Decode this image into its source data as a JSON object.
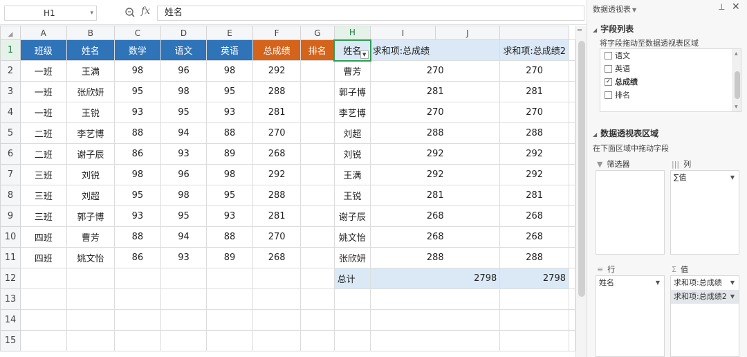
{
  "formula_bar": {
    "name_box": "H1",
    "fx_label": "fx",
    "formula_value": "姓名"
  },
  "columns": [
    "A",
    "B",
    "C",
    "D",
    "E",
    "F",
    "G",
    "H",
    "I",
    "J"
  ],
  "rows": [
    "1",
    "2",
    "3",
    "4",
    "5",
    "6",
    "7",
    "8",
    "9",
    "10",
    "11",
    "12",
    "13",
    "14",
    "15"
  ],
  "source_table": {
    "headers": [
      "班级",
      "姓名",
      "数学",
      "语文",
      "英语",
      "总成绩",
      "排名"
    ],
    "rows": [
      [
        "一班",
        "王满",
        "98",
        "96",
        "98",
        "292"
      ],
      [
        "一班",
        "张欣妍",
        "95",
        "98",
        "95",
        "288"
      ],
      [
        "一班",
        "王锐",
        "93",
        "95",
        "93",
        "281"
      ],
      [
        "二班",
        "李艺博",
        "88",
        "94",
        "88",
        "270"
      ],
      [
        "二班",
        "谢子辰",
        "86",
        "93",
        "89",
        "268"
      ],
      [
        "三班",
        "刘锐",
        "98",
        "96",
        "98",
        "292"
      ],
      [
        "三班",
        "刘超",
        "95",
        "98",
        "95",
        "288"
      ],
      [
        "三班",
        "郭子博",
        "93",
        "95",
        "93",
        "281"
      ],
      [
        "四班",
        "曹芳",
        "88",
        "94",
        "88",
        "270"
      ],
      [
        "四班",
        "姚文怡",
        "86",
        "93",
        "89",
        "268"
      ]
    ]
  },
  "pivot": {
    "headers": [
      "姓名",
      "求和项:总成绩",
      "求和项:总成绩2"
    ],
    "rows": [
      [
        "曹芳",
        "270",
        "270"
      ],
      [
        "郭子博",
        "281",
        "281"
      ],
      [
        "李艺博",
        "270",
        "270"
      ],
      [
        "刘超",
        "288",
        "288"
      ],
      [
        "刘锐",
        "292",
        "292"
      ],
      [
        "王满",
        "292",
        "292"
      ],
      [
        "王锐",
        "281",
        "281"
      ],
      [
        "谢子辰",
        "268",
        "268"
      ],
      [
        "姚文怡",
        "268",
        "268"
      ],
      [
        "张欣妍",
        "288",
        "288"
      ]
    ],
    "total": [
      "总计",
      "2798",
      "2798"
    ]
  },
  "panel": {
    "title": "数据透视表",
    "field_list_title": "字段列表",
    "field_list_hint": "将字段拖动至数据透视表区域",
    "fields": [
      {
        "label": "语文",
        "checked": false
      },
      {
        "label": "英语",
        "checked": false
      },
      {
        "label": "总成绩",
        "checked": true
      },
      {
        "label": "排名",
        "checked": false
      }
    ],
    "areas_title": "数据透视表区域",
    "areas_hint": "在下面区域中拖动字段",
    "filter_label": "筛选器",
    "columns_label": "列",
    "columns_item": "∑值",
    "rows_label": "行",
    "rows_item": "姓名",
    "values_label": "值",
    "values_items": [
      "求和项:总成绩",
      "求和项:总成绩2"
    ]
  },
  "colors": {
    "header_blue": "#2f73b8",
    "header_orange": "#d4641c",
    "pivot_header": "#dbe9f7",
    "selection_green": "#2e9c52"
  }
}
